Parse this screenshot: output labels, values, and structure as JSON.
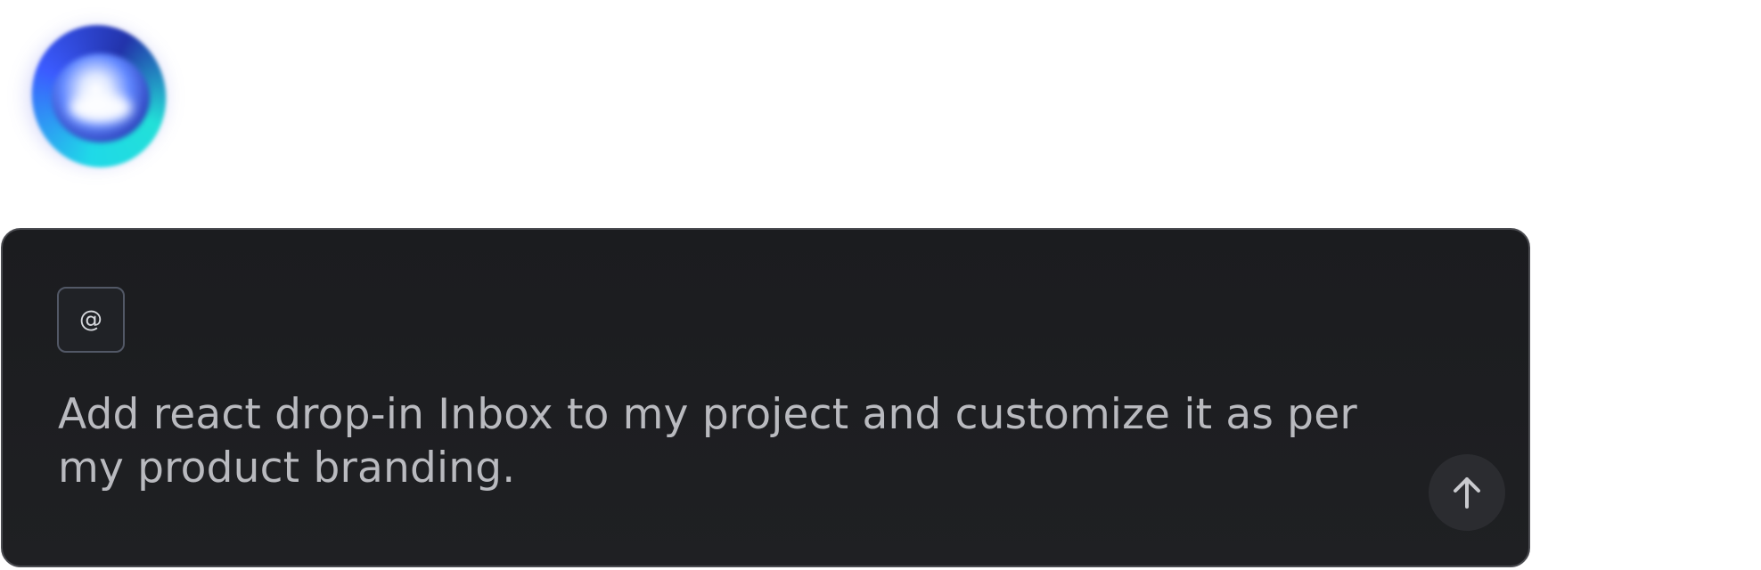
{
  "prompt": {
    "text": "Add react drop-in Inbox to my project and customize it as per my product branding.",
    "mention_button": {
      "glyph": "@",
      "icon": "at-sign-icon"
    },
    "send_button": {
      "icon": "arrow-up-icon"
    }
  },
  "logo": {
    "icon": "glowing-orb-icon"
  },
  "colors": {
    "card_background": "#1d1e21",
    "card_border": "#4a4b50",
    "text": "#b9babf",
    "send_button_bg": "#2b2c30",
    "orb_cyan": "#1fd9e8",
    "orb_blue": "#3b5bff"
  }
}
